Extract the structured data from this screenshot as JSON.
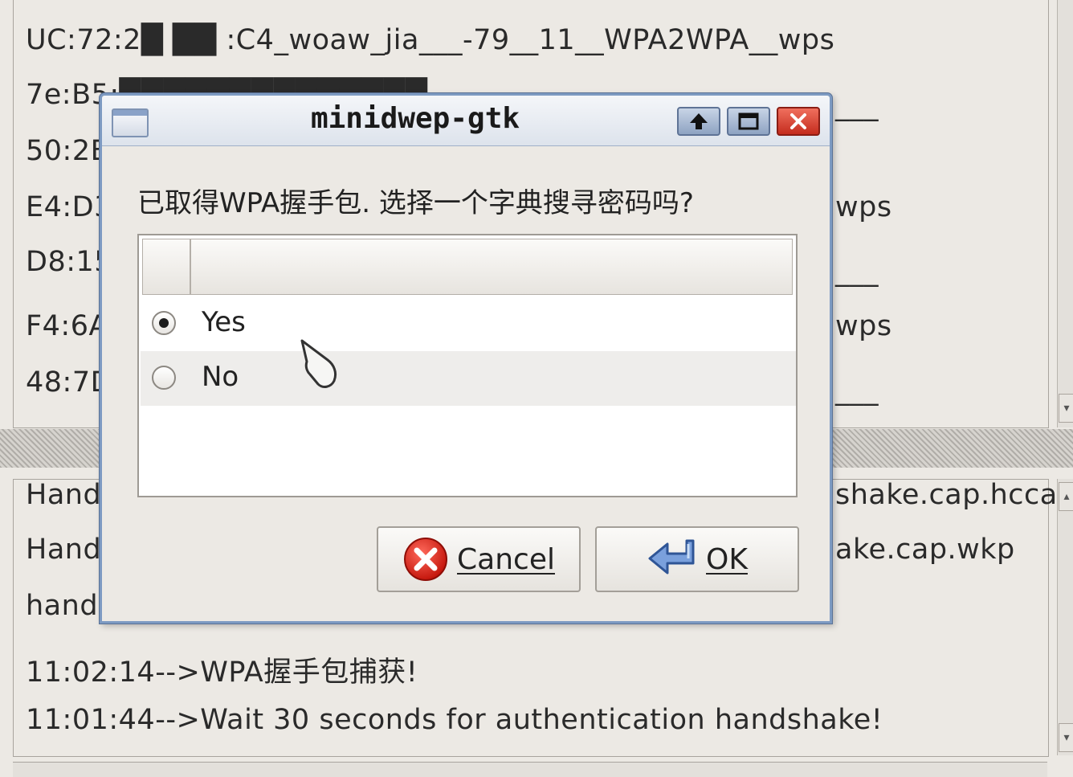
{
  "background": {
    "top_rows": [
      "UC:72:2█ ██ :C4_woaw_jia___-79__11__WPA2WPA__wps",
      "7e:B5:██████████████",
      "50:2B",
      "E4:D3",
      "D8:15",
      "F4:6A",
      "48:7D"
    ],
    "right_fragments": [
      "___",
      "wps",
      "___",
      "wps",
      "___"
    ],
    "log_rows": [
      {
        "left": "Hand",
        "right": "shake.cap.hcca"
      },
      {
        "left": "Hand",
        "right": "ake.cap.wkp"
      },
      {
        "left": "hand",
        "right": ""
      }
    ],
    "log_lines": [
      "11:02:14-->WPA握手包捕获!",
      "11:01:44-->Wait 30 seconds for authentication handshake!"
    ]
  },
  "dialog": {
    "title": "minidwep-gtk",
    "prompt": "已取得WPA握手包. 选择一个字典搜寻密码吗?",
    "options": [
      {
        "label": "Yes",
        "selected": true
      },
      {
        "label": "No",
        "selected": false
      }
    ],
    "cancel_label": "Cancel",
    "ok_label": "OK"
  },
  "colors": {
    "titlebar_border": "#7d9ac2",
    "close_button": "#c42c1e",
    "background": "#ece9e4"
  }
}
